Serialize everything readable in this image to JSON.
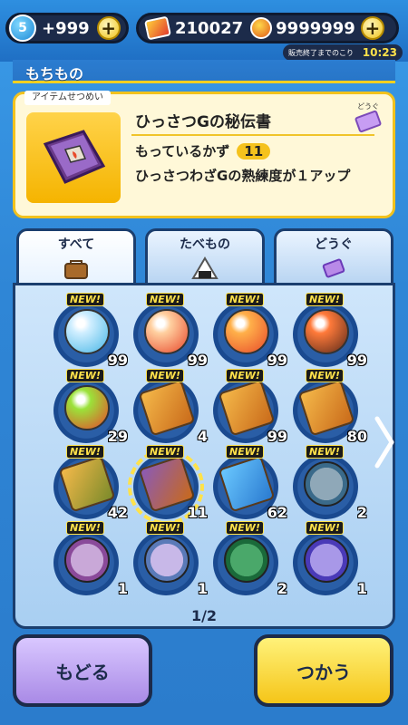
{
  "currency": {
    "level_badge": "5",
    "stamina": "+999",
    "coins": "210027",
    "money": "9999999",
    "timer_label": "販売終了までのこり",
    "timer_value": "10:23"
  },
  "section": {
    "title": "もちもの"
  },
  "description": {
    "tag": "アイテムせつめい",
    "item_name": "ひっさつGの秘伝書",
    "count_label": "もっているかず",
    "count_value": "11",
    "text": "ひっさつわざGの熟練度が１アップ",
    "category_mark": "どうぐ"
  },
  "tabs": [
    {
      "label": "すべて",
      "icon": "bag-icon"
    },
    {
      "label": "たべもの",
      "icon": "onigiri-icon"
    },
    {
      "label": "どうぐ",
      "icon": "ticket-icon"
    }
  ],
  "grid": {
    "new_label": "NEW!",
    "items": [
      {
        "qty": "99",
        "color": "#cfeeff",
        "accent": "#46b6e6",
        "kind": "orb"
      },
      {
        "qty": "99",
        "color": "#ffd0a0",
        "accent": "#e8462a",
        "kind": "orb"
      },
      {
        "qty": "99",
        "color": "#ffb04a",
        "accent": "#e84a2a",
        "kind": "fire"
      },
      {
        "qty": "99",
        "color": "#ff7a3a",
        "accent": "#5a2a1a",
        "kind": "orb"
      },
      {
        "qty": "29",
        "color": "#9be23a",
        "accent": "#e8462a",
        "kind": "orb"
      },
      {
        "qty": "4",
        "color": "#f5b94a",
        "accent": "#c96a1a",
        "kind": "book"
      },
      {
        "qty": "99",
        "color": "#f5b94a",
        "accent": "#c96a1a",
        "kind": "book"
      },
      {
        "qty": "80",
        "color": "#f5b94a",
        "accent": "#c96a1a",
        "kind": "book"
      },
      {
        "qty": "42",
        "color": "#f5b94a",
        "accent": "#7a8a2a",
        "kind": "book"
      },
      {
        "qty": "11",
        "color": "#8a5ab8",
        "accent": "#c96a1a",
        "kind": "book",
        "selected": true
      },
      {
        "qty": "62",
        "color": "#6ac8ff",
        "accent": "#2a7ad0",
        "kind": "book"
      },
      {
        "qty": "2",
        "color": "#8fa8b8",
        "accent": "#3a6a8a",
        "kind": "coin"
      },
      {
        "qty": "1",
        "color": "#c9a8d8",
        "accent": "#8a4a9a",
        "kind": "coin"
      },
      {
        "qty": "1",
        "color": "#c8b8e8",
        "accent": "#5a7ab8",
        "kind": "coin"
      },
      {
        "qty": "2",
        "color": "#4aa86a",
        "accent": "#1a6a3a",
        "kind": "coin"
      },
      {
        "qty": "1",
        "color": "#a898e8",
        "accent": "#4a3ab8",
        "kind": "coin"
      }
    ]
  },
  "pagination": {
    "text": "1/2"
  },
  "buttons": {
    "back": "もどる",
    "use": "つかう"
  }
}
